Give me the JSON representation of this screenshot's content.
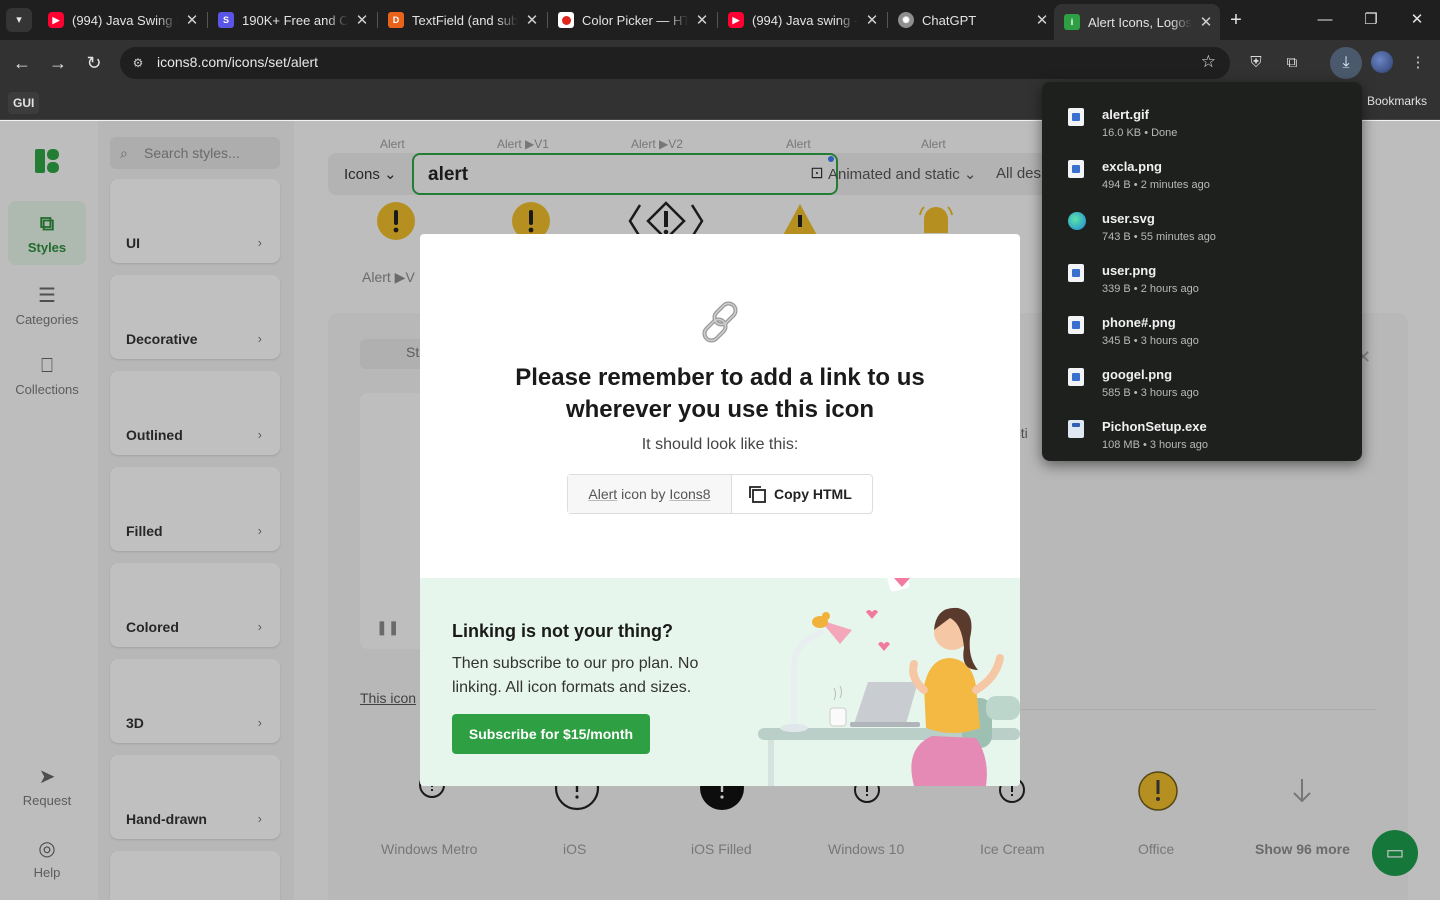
{
  "browser": {
    "tabs": [
      {
        "title": "(994) Java Swing U",
        "favicon_color": "#ff0033",
        "favicon": "yt"
      },
      {
        "title": "190K+ Free and O",
        "favicon_color": "#5a55e6",
        "favicon": "S"
      },
      {
        "title": "TextField (and sub",
        "favicon_color": "#e8621a",
        "favicon": "D"
      },
      {
        "title": "Color Picker — HT",
        "favicon_color": "#ffffff",
        "favicon": "cp"
      },
      {
        "title": "(994) Java swing -",
        "favicon_color": "#ff0033",
        "favicon": "yt"
      },
      {
        "title": "ChatGPT",
        "favicon_color": "#9e9e9e",
        "favicon": "gpt"
      },
      {
        "title": "Alert Icons, Logos,",
        "favicon_color": "#2ea043",
        "favicon": "i8",
        "active": true
      }
    ],
    "url": "icons8.com/icons/set/alert",
    "bookmark_folder": "GUI",
    "bookmarks_label": "Bookmarks"
  },
  "leftnav": {
    "items": [
      {
        "label": "Styles",
        "icon": "styles-icon",
        "active": true
      },
      {
        "label": "Categories",
        "icon": "list-icon"
      },
      {
        "label": "Collections",
        "icon": "bookmark-icon"
      }
    ],
    "bottom": [
      {
        "label": "Request",
        "icon": "send-icon"
      },
      {
        "label": "Help",
        "icon": "lifebuoy-icon"
      }
    ]
  },
  "styles_panel": {
    "search_placeholder": "Search styles...",
    "cards": [
      {
        "name": "UI"
      },
      {
        "name": "Decorative"
      },
      {
        "name": "Outlined"
      },
      {
        "name": "Filled"
      },
      {
        "name": "Colored"
      },
      {
        "name": "3D"
      },
      {
        "name": "Hand-drawn"
      }
    ]
  },
  "main": {
    "search": {
      "type_selector": "Icons",
      "query": "alert",
      "filter_animated": "Animated and static",
      "filter_all": "All des"
    },
    "top_labels": [
      "Alert",
      "Alert ▶V1",
      "Alert ▶V2",
      "Alert",
      "Alert"
    ],
    "row_label": "Alert ▶V",
    "side_label_st": "St",
    "side_label_this_icon": "This icon",
    "side_label_ecti": "ecti",
    "bottom_styles": [
      "Windows Metro",
      "iOS",
      "iOS Filled",
      "Windows 10",
      "Ice Cream",
      "Office",
      "Show 96 more"
    ]
  },
  "modal": {
    "title": "Please remember to add a link to us wherever you use this icon",
    "subtitle": "It should look like this:",
    "attribution_text": "Alert icon by Icons8",
    "attribution_alert": "Alert",
    "attribution_icon": "icon",
    "attribution_by": "by",
    "attribution_icons8": "Icons8",
    "copy_html": "Copy HTML",
    "promo_title": "Linking is not your thing?",
    "promo_body": "Then subscribe to our pro plan. No linking. All icon formats and sizes.",
    "cta": "Subscribe for $15/month"
  },
  "downloads": [
    {
      "name": "alert.gif",
      "meta": "16.0 KB • Done",
      "icon": "file-image-icon"
    },
    {
      "name": "excla.png",
      "meta": "494 B • 2 minutes ago",
      "icon": "file-image-icon"
    },
    {
      "name": "user.svg",
      "meta": "743 B • 55 minutes ago",
      "icon": "edge-icon"
    },
    {
      "name": "user.png",
      "meta": "339 B • 2 hours ago",
      "icon": "file-image-icon"
    },
    {
      "name": "phone#.png",
      "meta": "345 B • 3 hours ago",
      "icon": "file-image-icon"
    },
    {
      "name": "googel.png",
      "meta": "585 B • 3 hours ago",
      "icon": "file-image-icon"
    },
    {
      "name": "PichonSetup.exe",
      "meta": "108 MB • 3 hours ago",
      "icon": "installer-icon"
    }
  ],
  "colors": {
    "accent_green": "#2ea043",
    "chrome_dark": "#1f1f1f",
    "downloads_bg": "#1e201e",
    "promo_bg": "#e7f6ed"
  }
}
